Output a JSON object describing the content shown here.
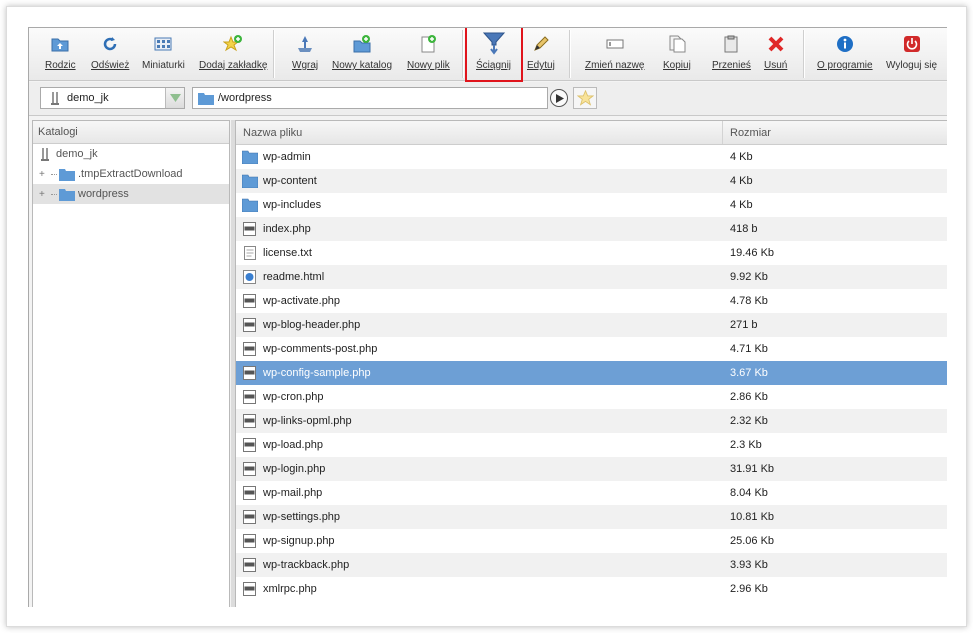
{
  "toolbar": {
    "buttons": [
      {
        "label": "Rodzic",
        "icon": "folder-up-icon"
      },
      {
        "label": "Odśwież",
        "icon": "refresh-icon"
      },
      {
        "label": "Miniaturki",
        "icon": "thumbnails-icon"
      },
      {
        "label": "Dodaj zakładkę",
        "icon": "add-bookmark-icon"
      },
      {
        "label": "Wgraj",
        "icon": "upload-icon"
      },
      {
        "label": "Nowy katalog",
        "icon": "new-folder-icon"
      },
      {
        "label": "Nowy plik",
        "icon": "new-file-icon"
      },
      {
        "label": "Ściągnij",
        "icon": "download-icon"
      },
      {
        "label": "Edytuj",
        "icon": "edit-icon"
      },
      {
        "label": "Zmień nazwę",
        "icon": "rename-icon"
      },
      {
        "label": "Kopiuj",
        "icon": "copy-icon"
      },
      {
        "label": "Przenieś",
        "icon": "move-icon"
      },
      {
        "label": "Usuń",
        "icon": "delete-icon"
      },
      {
        "label": "O programie",
        "icon": "info-icon"
      },
      {
        "label": "Wyloguj się",
        "icon": "logout-icon"
      }
    ],
    "highlighted": "Ściągnij",
    "highlight_color": "#e0141c"
  },
  "address": {
    "connection": "demo_jk",
    "path": "/wordpress"
  },
  "left_panel": {
    "header": "Katalogi",
    "tree": [
      {
        "label": "demo_jk",
        "type": "server",
        "expander": ""
      },
      {
        "label": ".tmpExtractDownload",
        "type": "folder",
        "expander": "+"
      },
      {
        "label": "wordpress",
        "type": "folder",
        "expander": "+",
        "selected": true
      }
    ]
  },
  "file_list": {
    "columns": {
      "name": "Nazwa pliku",
      "size": "Rozmiar"
    },
    "selected_color": "#6d9fd5",
    "rows": [
      {
        "name": "wp-admin",
        "size": "4 Kb",
        "type": "folder"
      },
      {
        "name": "wp-content",
        "size": "4 Kb",
        "type": "folder"
      },
      {
        "name": "wp-includes",
        "size": "4 Kb",
        "type": "folder"
      },
      {
        "name": "index.php",
        "size": "418 b",
        "type": "php"
      },
      {
        "name": "license.txt",
        "size": "19.46 Kb",
        "type": "txt"
      },
      {
        "name": "readme.html",
        "size": "9.92 Kb",
        "type": "html"
      },
      {
        "name": "wp-activate.php",
        "size": "4.78 Kb",
        "type": "php"
      },
      {
        "name": "wp-blog-header.php",
        "size": "271 b",
        "type": "php"
      },
      {
        "name": "wp-comments-post.php",
        "size": "4.71 Kb",
        "type": "php"
      },
      {
        "name": "wp-config-sample.php",
        "size": "3.67 Kb",
        "type": "php",
        "selected": true
      },
      {
        "name": "wp-cron.php",
        "size": "2.86 Kb",
        "type": "php"
      },
      {
        "name": "wp-links-opml.php",
        "size": "2.32 Kb",
        "type": "php"
      },
      {
        "name": "wp-load.php",
        "size": "2.3 Kb",
        "type": "php"
      },
      {
        "name": "wp-login.php",
        "size": "31.91 Kb",
        "type": "php"
      },
      {
        "name": "wp-mail.php",
        "size": "8.04 Kb",
        "type": "php"
      },
      {
        "name": "wp-settings.php",
        "size": "10.81 Kb",
        "type": "php"
      },
      {
        "name": "wp-signup.php",
        "size": "25.06 Kb",
        "type": "php"
      },
      {
        "name": "wp-trackback.php",
        "size": "3.93 Kb",
        "type": "php"
      },
      {
        "name": "xmlrpc.php",
        "size": "2.96 Kb",
        "type": "php"
      }
    ]
  }
}
